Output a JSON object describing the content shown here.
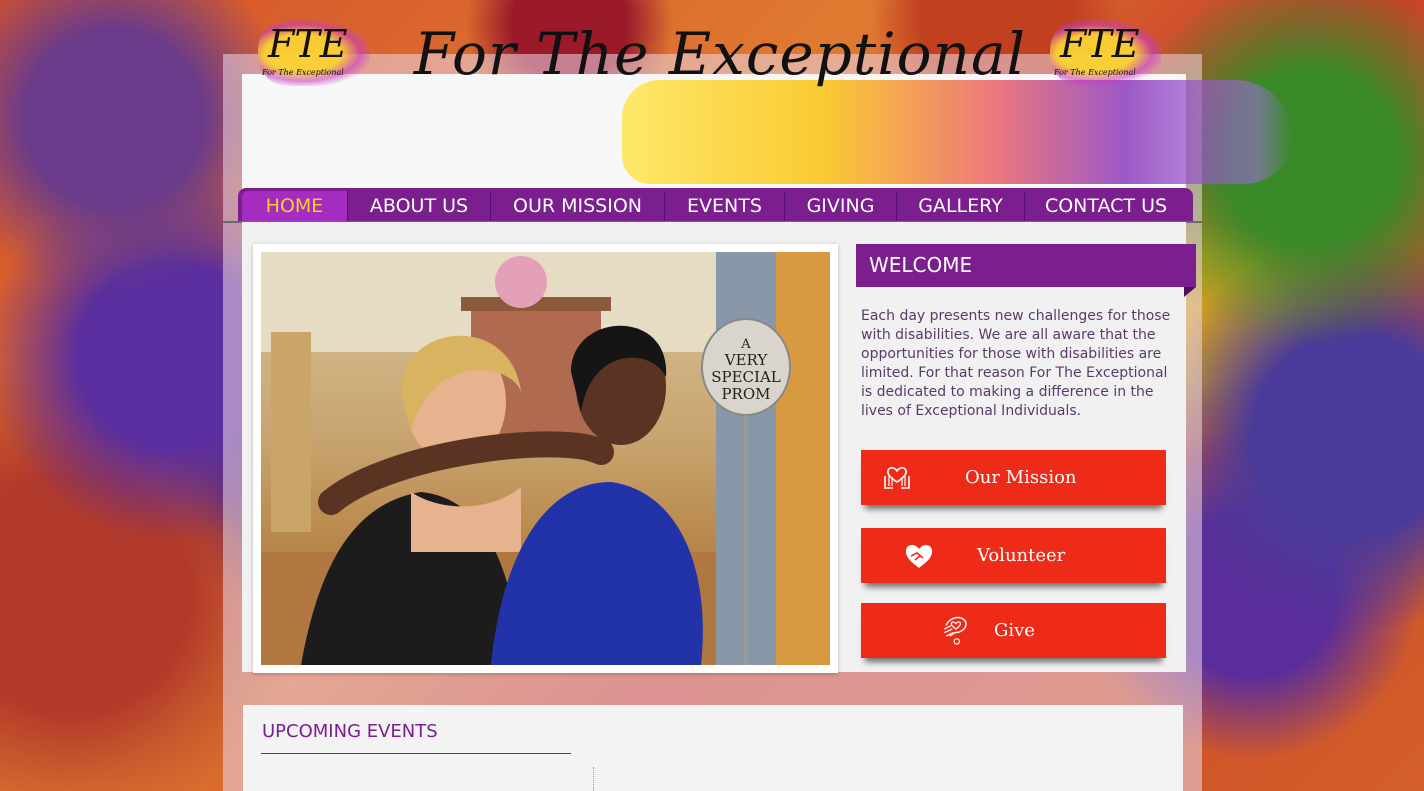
{
  "header": {
    "site_title": "For The Exceptional",
    "logo_mark": "FTE",
    "logo_sub": "For The Exceptional"
  },
  "nav": {
    "items": [
      "HOME",
      "ABOUT US",
      "OUR MISSION",
      "EVENTS",
      "GIVING",
      "GALLERY",
      "CONTACT US"
    ],
    "active": "HOME"
  },
  "photo": {
    "sign_text": "A VERY SPECIAL PROM"
  },
  "welcome": {
    "title": "WELCOME",
    "body": "Each day presents new challenges for those with disabilities. We are all aware that the opportunities for those with disabilities are limited. For that reason For The Exceptional is dedicated to making a difference in the lives of Exceptional Individuals."
  },
  "ctas": [
    {
      "label": "Our Mission",
      "icon": "hands-heart-icon"
    },
    {
      "label": "Volunteer",
      "icon": "handshake-heart-icon"
    },
    {
      "label": "Give",
      "icon": "giving-hand-icon"
    }
  ],
  "events": {
    "title": "UPCOMING EVENTS"
  },
  "colors": {
    "purple": "#7b1e8e",
    "active_nav": "#a52cc0",
    "active_text": "#f5d020",
    "cta_red": "#ee2b18"
  }
}
